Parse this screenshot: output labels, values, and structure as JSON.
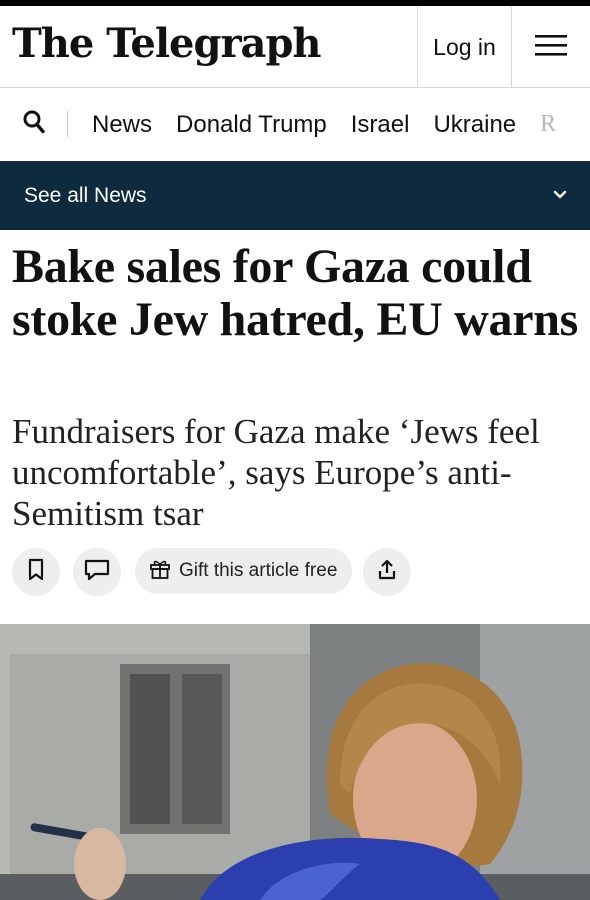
{
  "masthead": {
    "logo": "The Telegraph",
    "login_label": "Log in"
  },
  "nav": {
    "items": [
      "News",
      "Donald Trump",
      "Israel",
      "Ukraine",
      "R"
    ]
  },
  "section_bar": {
    "label": "See all News"
  },
  "article": {
    "headline": "Bake sales for Gaza could stoke Jew hatred, EU warns",
    "standfirst": "Fundraisers for Gaza make ‘Jews feel uncomfortable’, says Europe’s anti-Semitism tsar",
    "gift_label": "Gift this article free"
  },
  "icons": {
    "search": "search-icon",
    "menu": "hamburger-menu-icon",
    "chevron": "chevron-down-icon",
    "bookmark": "bookmark-icon",
    "comment": "comment-icon",
    "gift": "gift-icon",
    "share": "share-icon"
  },
  "colors": {
    "section_bar_bg": "#0e2a3e",
    "button_bg": "#eeeeee"
  }
}
